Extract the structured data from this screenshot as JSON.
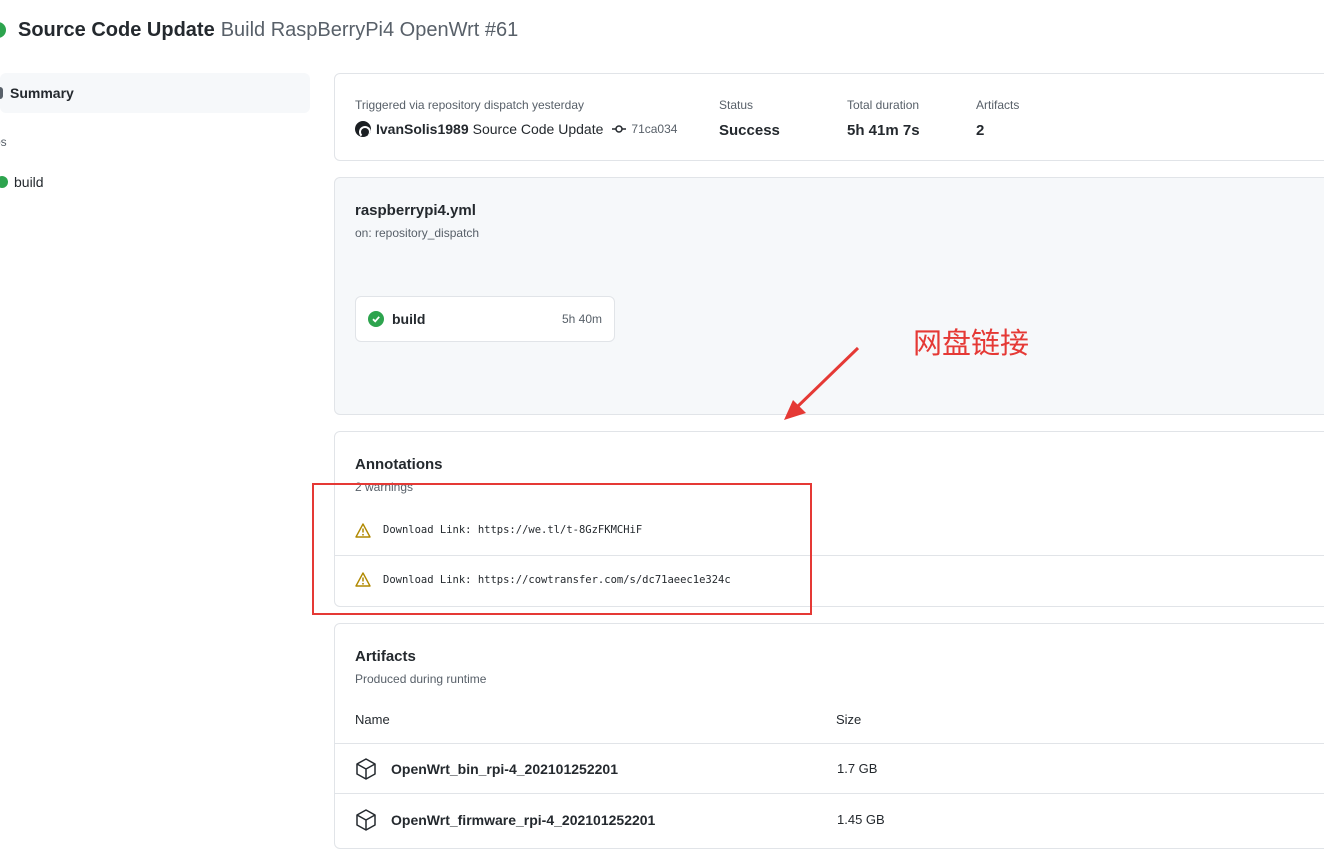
{
  "header": {
    "workflow_title": "Source Code Update",
    "run_subtitle": "Build RaspBerryPi4 OpenWrt #61"
  },
  "sidebar": {
    "summary_label": "Summary",
    "jobs_heading": "bs",
    "jobs": [
      {
        "label": "build",
        "status": "success"
      }
    ]
  },
  "summary": {
    "trigger_label": "Triggered via repository dispatch yesterday",
    "actor": "IvanSolis1989",
    "trigger_text": "Source Code Update",
    "commit_sha": "71ca034",
    "status_label": "Status",
    "status_value": "Success",
    "duration_label": "Total duration",
    "duration_value": "5h 41m 7s",
    "artifacts_label": "Artifacts",
    "artifacts_value": "2"
  },
  "workflow_graph": {
    "file_name": "raspberrypi4.yml",
    "trigger_event": "on: repository_dispatch",
    "jobs": [
      {
        "name": "build",
        "duration": "5h 40m",
        "status": "success"
      }
    ]
  },
  "annotations": {
    "title": "Annotations",
    "subtitle": "2 warnings",
    "items": [
      {
        "level": "warning",
        "text": "Download Link: https://we.tl/t-8GzFKMCHiF"
      },
      {
        "level": "warning",
        "text": "Download Link: https://cowtransfer.com/s/dc71aeec1e324c"
      }
    ]
  },
  "artifacts": {
    "title": "Artifacts",
    "subtitle": "Produced during runtime",
    "columns": [
      "Name",
      "Size"
    ],
    "rows": [
      {
        "name": "OpenWrt_bin_rpi-4_202101252201",
        "size": "1.7 GB"
      },
      {
        "name": "OpenWrt_firmware_rpi-4_202101252201",
        "size": "1.45 GB"
      }
    ]
  },
  "overlay": {
    "callout_text": "网盘链接",
    "callout_color": "#e53935"
  },
  "colors": {
    "success": "#2da44e",
    "warning": "#b08800",
    "border": "#e1e4e8",
    "muted_text": "#586069"
  }
}
